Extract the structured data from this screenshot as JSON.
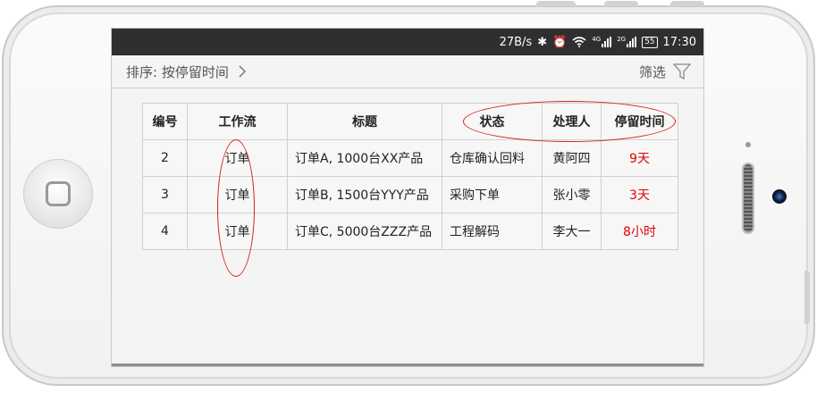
{
  "statusbar": {
    "net_speed": "27B/s",
    "net_4g": "4G",
    "net_2g": "2G",
    "battery": "55",
    "time": "17:30"
  },
  "toolbar": {
    "sort_label": "排序: 按停留时间",
    "filter_label": "筛选"
  },
  "table": {
    "headers": [
      "编号",
      "工作流",
      "标题",
      "状态",
      "处理人",
      "停留时间"
    ],
    "rows": [
      [
        "2",
        "订单",
        "订单A, 1000台XX产品",
        "仓库确认回料",
        "黄阿四",
        "9天"
      ],
      [
        "3",
        "订单",
        "订单B, 1500台YYY产品",
        "采购下单",
        "张小零",
        "3天"
      ],
      [
        "4",
        "订单",
        "订单C, 5000台ZZZ产品",
        "工程解码",
        "李大一",
        "8小时"
      ]
    ]
  },
  "colors": {
    "highlight": "#e20000",
    "statusbar_bg": "#2f2f31",
    "annotation_circle": "#d41f1f"
  }
}
